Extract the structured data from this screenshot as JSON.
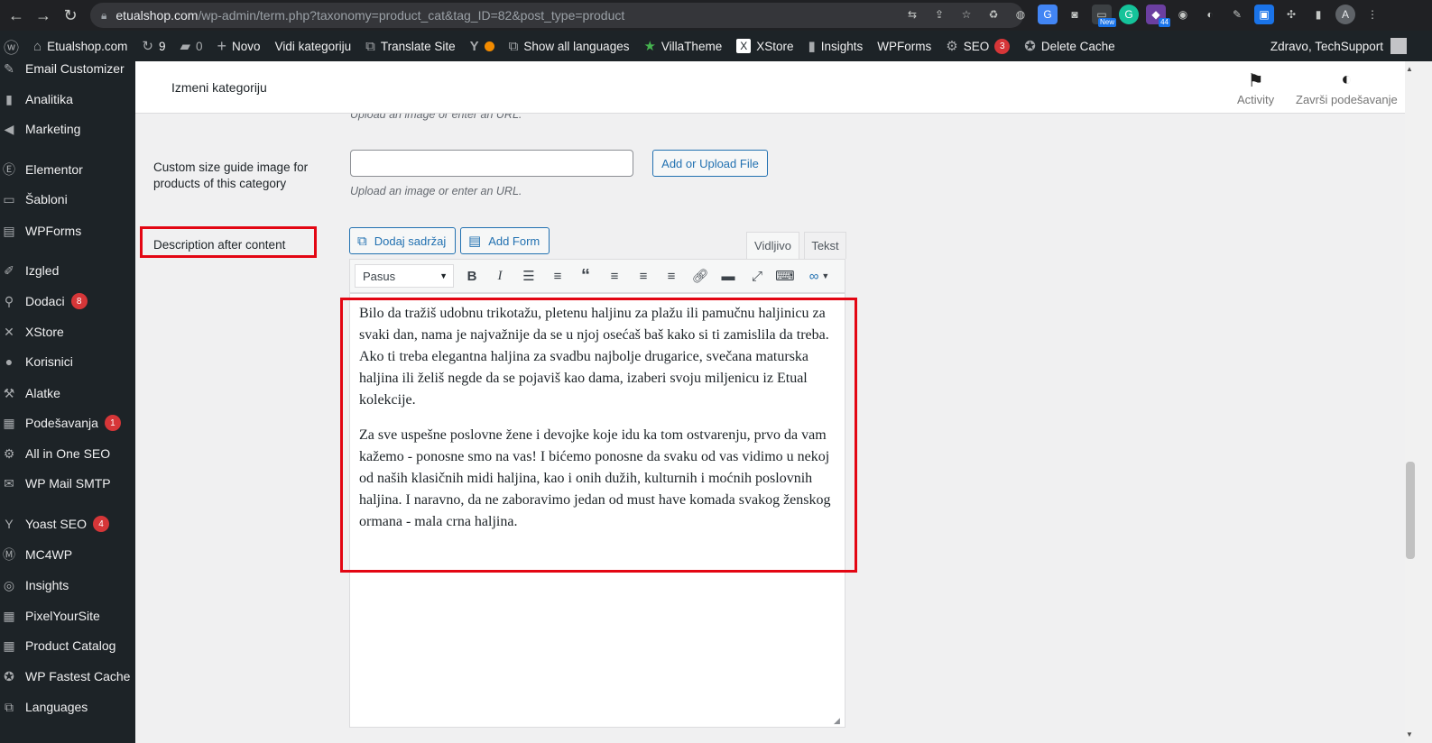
{
  "browser": {
    "url_domain": "etualshop.com",
    "url_path": "/wp-admin/term.php?taxonomy=product_cat&tag_ID=82&post_type=product",
    "ext_new_badge": "New",
    "ext_count_badge": "44",
    "avatar_letter": "A"
  },
  "admin_bar": {
    "site_name": "Etualshop.com",
    "updates_count": "9",
    "comments_count": "0",
    "new_label": "Novo",
    "view_category": "Vidi kategoriju",
    "translate_site": "Translate Site",
    "show_languages": "Show all languages",
    "villatheme": "VillaTheme",
    "xstore": "XStore",
    "insights": "Insights",
    "wpforms": "WPForms",
    "seo": "SEO",
    "seo_badge": "3",
    "delete_cache": "Delete Cache",
    "greeting": "Zdravo, TechSupport"
  },
  "sidebar": {
    "items": [
      {
        "label": "Email Customizer",
        "icon": "pen-icon"
      },
      {
        "label": "Analitika",
        "icon": "bar-chart-icon"
      },
      {
        "label": "Marketing",
        "icon": "megaphone-icon"
      },
      {
        "label": "Elementor",
        "icon": "elementor-icon"
      },
      {
        "label": "Šabloni",
        "icon": "folder-icon"
      },
      {
        "label": "WPForms",
        "icon": "form-icon"
      },
      {
        "label": "Izgled",
        "icon": "brush-icon"
      },
      {
        "label": "Dodaci",
        "icon": "plugin-icon",
        "badge": "8"
      },
      {
        "label": "XStore",
        "icon": "xstore-icon"
      },
      {
        "label": "Korisnici",
        "icon": "user-icon"
      },
      {
        "label": "Alatke",
        "icon": "wrench-icon"
      },
      {
        "label": "Podešavanja",
        "icon": "settings-icon",
        "badge": "1"
      },
      {
        "label": "All in One SEO",
        "icon": "seo-icon"
      },
      {
        "label": "WP Mail SMTP",
        "icon": "mail-icon"
      },
      {
        "label": "Yoast SEO",
        "icon": "yoast-icon",
        "badge": "4"
      },
      {
        "label": "MC4WP",
        "icon": "mc4wp-icon"
      },
      {
        "label": "Insights",
        "icon": "insights-icon"
      },
      {
        "label": "PixelYourSite",
        "icon": "grid-icon"
      },
      {
        "label": "Product Catalog",
        "icon": "grid-icon"
      },
      {
        "label": "WP Fastest Cache",
        "icon": "cheetah-icon"
      },
      {
        "label": "Languages",
        "icon": "translate-icon"
      }
    ]
  },
  "header": {
    "title": "Izmeni kategoriju",
    "activity": "Activity",
    "finish_setup": "Završi podešavanje"
  },
  "form": {
    "top_hint": "Upload an image or enter an URL.",
    "size_guide_label": "Custom size guide image for products of this category",
    "size_guide_value": "",
    "upload_button": "Add or Upload File",
    "size_guide_hint": "Upload an image or enter an URL.",
    "description_label": "Description after content"
  },
  "editor": {
    "add_media": "Dodaj sadržaj",
    "add_form": "Add Form",
    "tab_visual": "Vidljivo",
    "tab_text": "Tekst",
    "format": "Pasus",
    "paragraphs": [
      "Bilo da tražiš udobnu trikotažu, pletenu haljinu za plažu ili pamučnu haljinicu za svaki dan, nama je najvažnije da se u njoj osećaš baš kako si ti zamislila da treba. Ako ti treba elegantna haljina za svadbu najbolje drugarice, svečana maturska haljina ili želiš negde da se pojaviš kao dama, izaberi svoju miljenicu iz Etual kolekcije.",
      "Za sve uspešne poslovne žene i devojke koje idu ka tom ostvarenju, prvo da vam kažemo - ponosne smo na vas! I bićemo ponosne da svaku od vas vidimo u nekoj od naših klasičnih midi haljina, kao i onih dužih, kulturnih i moćnih poslovnih haljina. I naravno, da ne zaboravimo jedan od must have komada svakog ženskog ormana - mala crna haljina."
    ]
  },
  "colors": {
    "wp_dark": "#1d2327",
    "wp_blue": "#2271b1",
    "badge_red": "#d63638",
    "highlight_red": "#e30613"
  }
}
